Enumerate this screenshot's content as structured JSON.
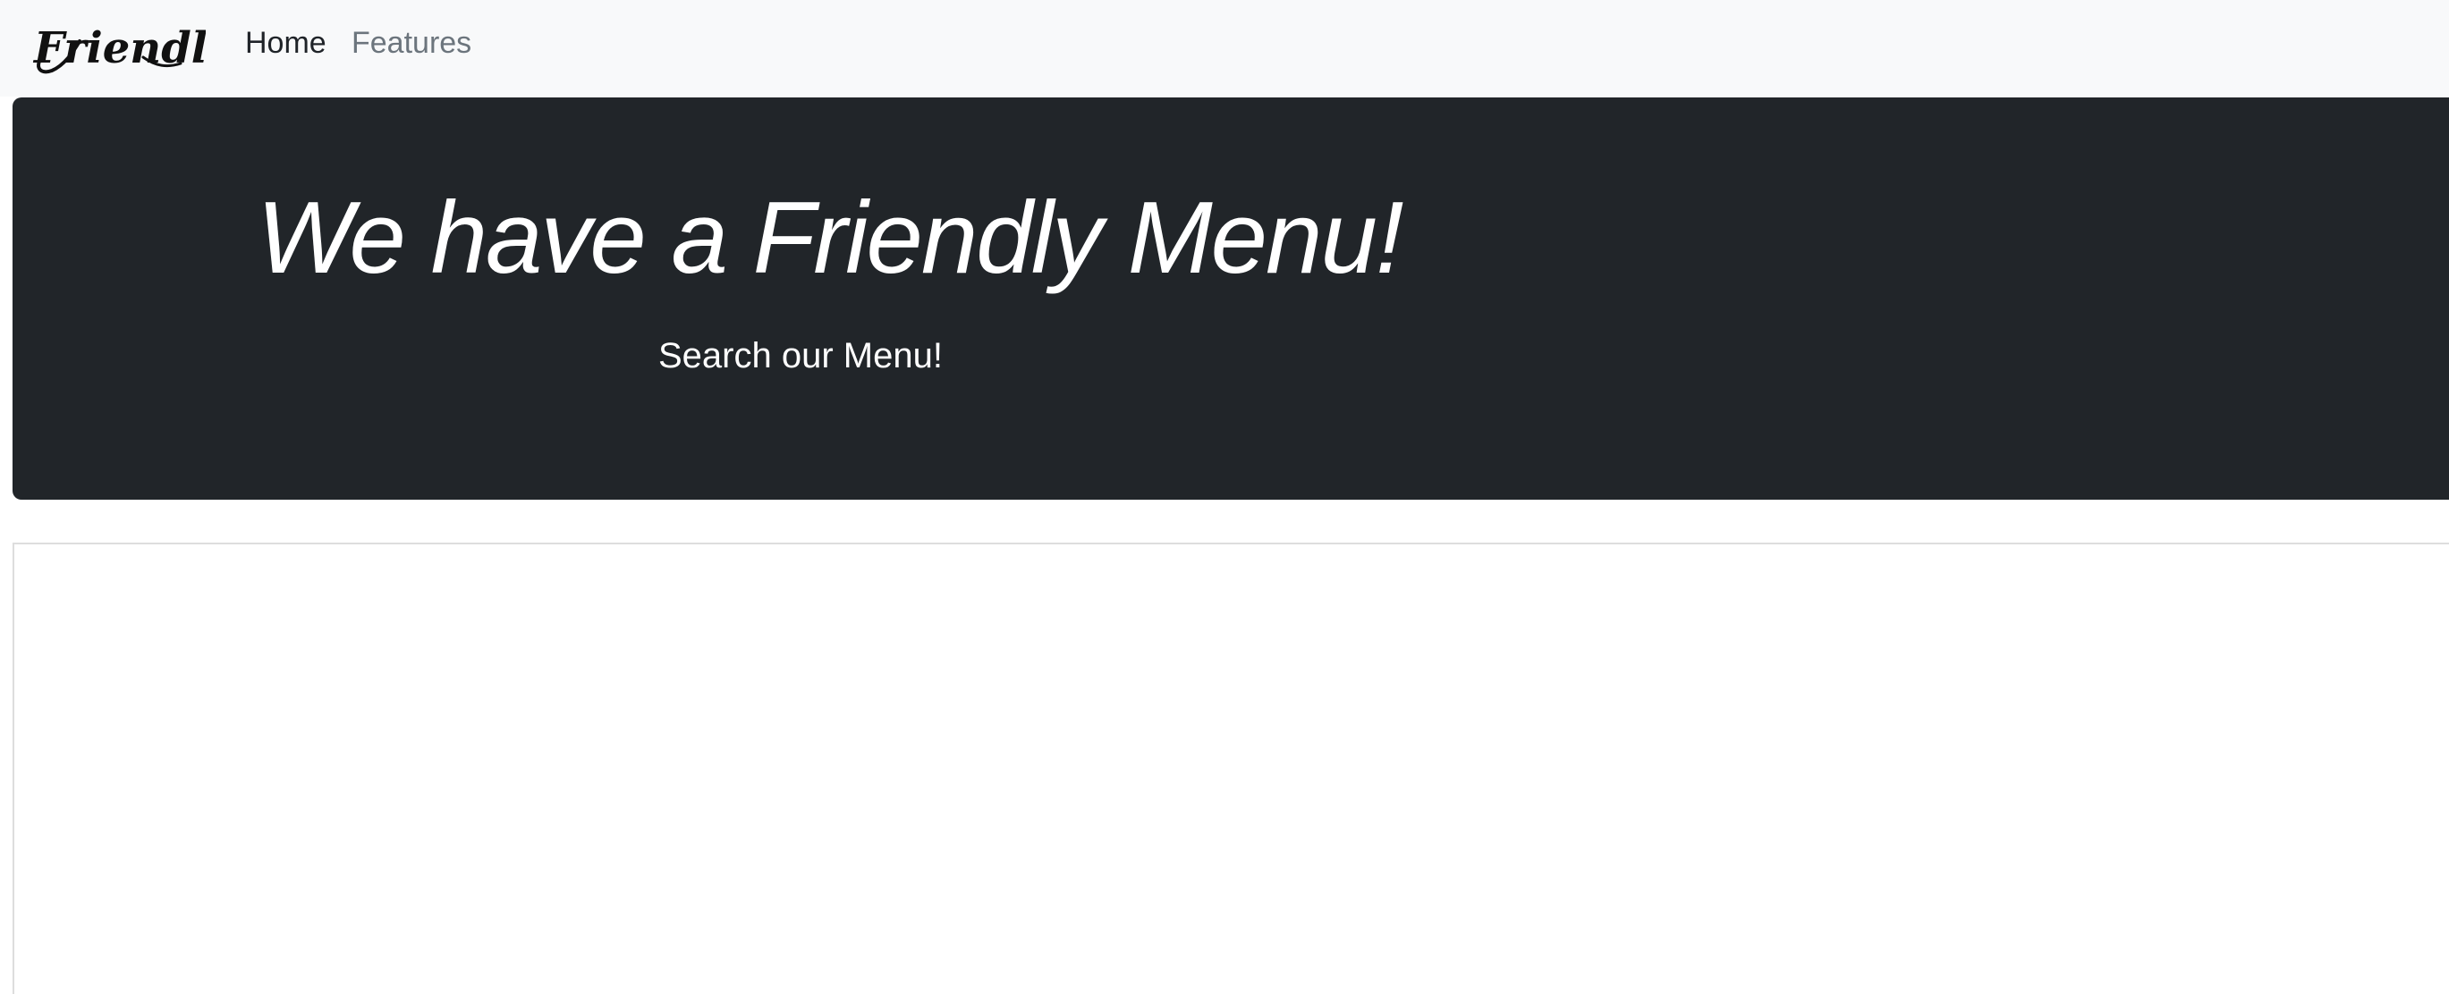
{
  "navbar": {
    "brand": "Friendly's",
    "items": [
      {
        "label": "Home"
      },
      {
        "label": "Features"
      }
    ]
  },
  "hero": {
    "title": "We have a Friendly Menu!",
    "subtitle": "Search our Menu!"
  },
  "colors": {
    "navbar_background": "#f8f9fa",
    "hero_background": "#212529",
    "active_nav": "#1f2328",
    "inactive_nav": "#6c757d",
    "hero_text": "#ffffff"
  }
}
